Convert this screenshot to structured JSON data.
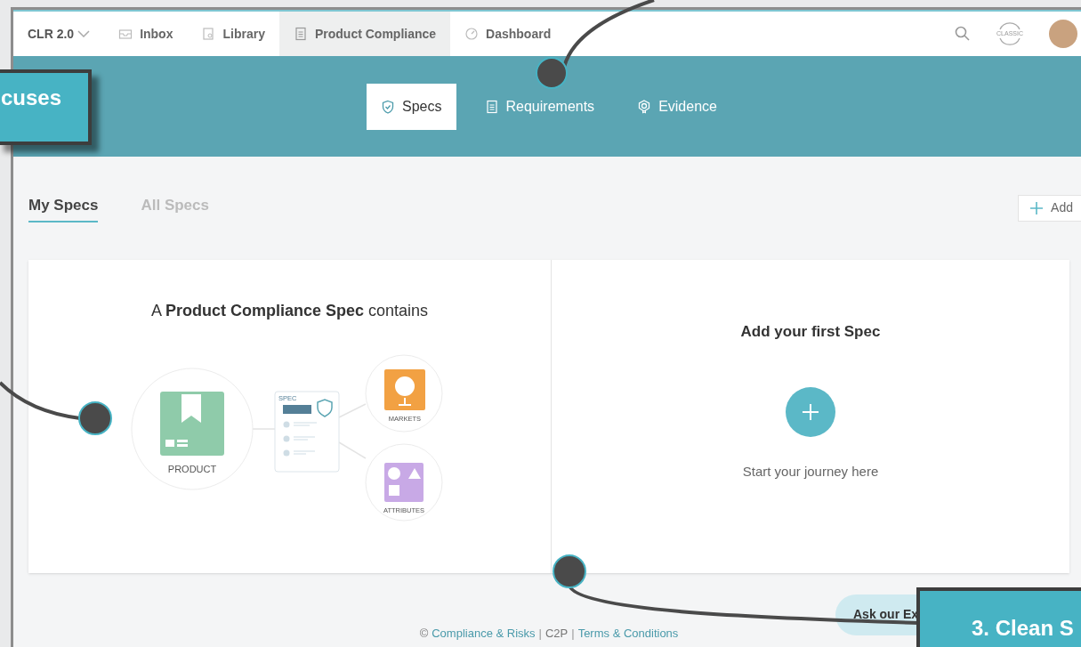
{
  "nav": {
    "brand": "CLR 2.0",
    "items": [
      {
        "label": "Inbox",
        "selected": false
      },
      {
        "label": "Library",
        "selected": false
      },
      {
        "label": "Product Compliance",
        "selected": true
      },
      {
        "label": "Dashboard",
        "selected": false
      }
    ],
    "classic": "CLASSIC"
  },
  "section_tabs": [
    {
      "label": "Specs",
      "selected": true
    },
    {
      "label": "Requirements",
      "selected": false
    },
    {
      "label": "Evidence",
      "selected": false
    }
  ],
  "spec_tabs": [
    {
      "label": "My Specs",
      "selected": true
    },
    {
      "label": "All Specs",
      "selected": false
    }
  ],
  "add_button": "Add",
  "intro": {
    "heading": "A **Product Compliance Spec** contains",
    "product": "PRODUCT",
    "spec": "SPEC",
    "markets": "MARKETS",
    "attributes": "ATTRIBUTES"
  },
  "empty": {
    "title": "Add your first Spec",
    "hint": "Start your journey here"
  },
  "footer": [
    {
      "kind": "text",
      "text": "©"
    },
    {
      "kind": "link",
      "text": "Compliance & Risks"
    },
    {
      "kind": "separator",
      "text": "|"
    },
    {
      "kind": "text",
      "text": "C2P"
    },
    {
      "kind": "separator",
      "text": "|"
    },
    {
      "kind": "link",
      "text": "Terms & Conditions"
    }
  ],
  "ask_button": "Ask our Ex",
  "callouts": [
    "cuses",
    "3. Clean S"
  ]
}
